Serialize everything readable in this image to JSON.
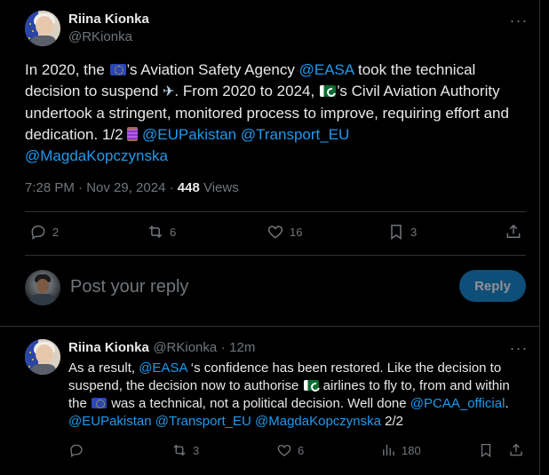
{
  "main_tweet": {
    "author_name": "Riina Kionka",
    "author_handle": "@RKionka",
    "text": {
      "p1": "In 2020, the ",
      "p2": "’s Aviation Safety Agency ",
      "mention_easa": "@EASA",
      "p3": " took the technical decision to suspend ",
      "p4": ". From 2020 to 2024, ",
      "p5": "’s Civil Aviation Authority undertook a stringent, monitored process to improve, requiring effort and dedication.  1/2 ",
      "mention_eupak": "@EUPakistan",
      "mention_transport": "@Transport_EU",
      "mention_magda": "@MagdaKopczynska"
    },
    "timestamp": "7:28 PM · Nov 29, 2024 · ",
    "views_count": "448",
    "views_label": " Views",
    "actions": {
      "replies": "2",
      "reposts": "6",
      "likes": "16",
      "bookmarks": "3"
    }
  },
  "reply_composer": {
    "placeholder": "Post your reply",
    "button_label": "Reply"
  },
  "reply_tweet": {
    "author_name": "Riina Kionka",
    "author_handle": "@RKionka",
    "time": "12m",
    "text": {
      "p1": "As a result, ",
      "mention_easa": "@EASA",
      "p2": " ‘s confidence has been restored. Like the decision to suspend, the decision now to authorise ",
      "p3": " airlines to fly to, from and within the ",
      "p4": " was a technical, not a political decision.  Well done ",
      "mention_pcaa": "@PCAA_official",
      "p5": ".",
      "mention_eupak": "@EUPakistan",
      "mention_transport": "@Transport_EU",
      "mention_magda": "@MagdaKopczynska",
      "p6": " 2/2"
    },
    "actions": {
      "replies": "",
      "reposts": "3",
      "likes": "6",
      "views": "180"
    }
  },
  "colors": {
    "background": "#000000",
    "text": "#e7e9ea",
    "muted": "#71767b",
    "link": "#1d9bf0",
    "border": "#2f3336"
  }
}
